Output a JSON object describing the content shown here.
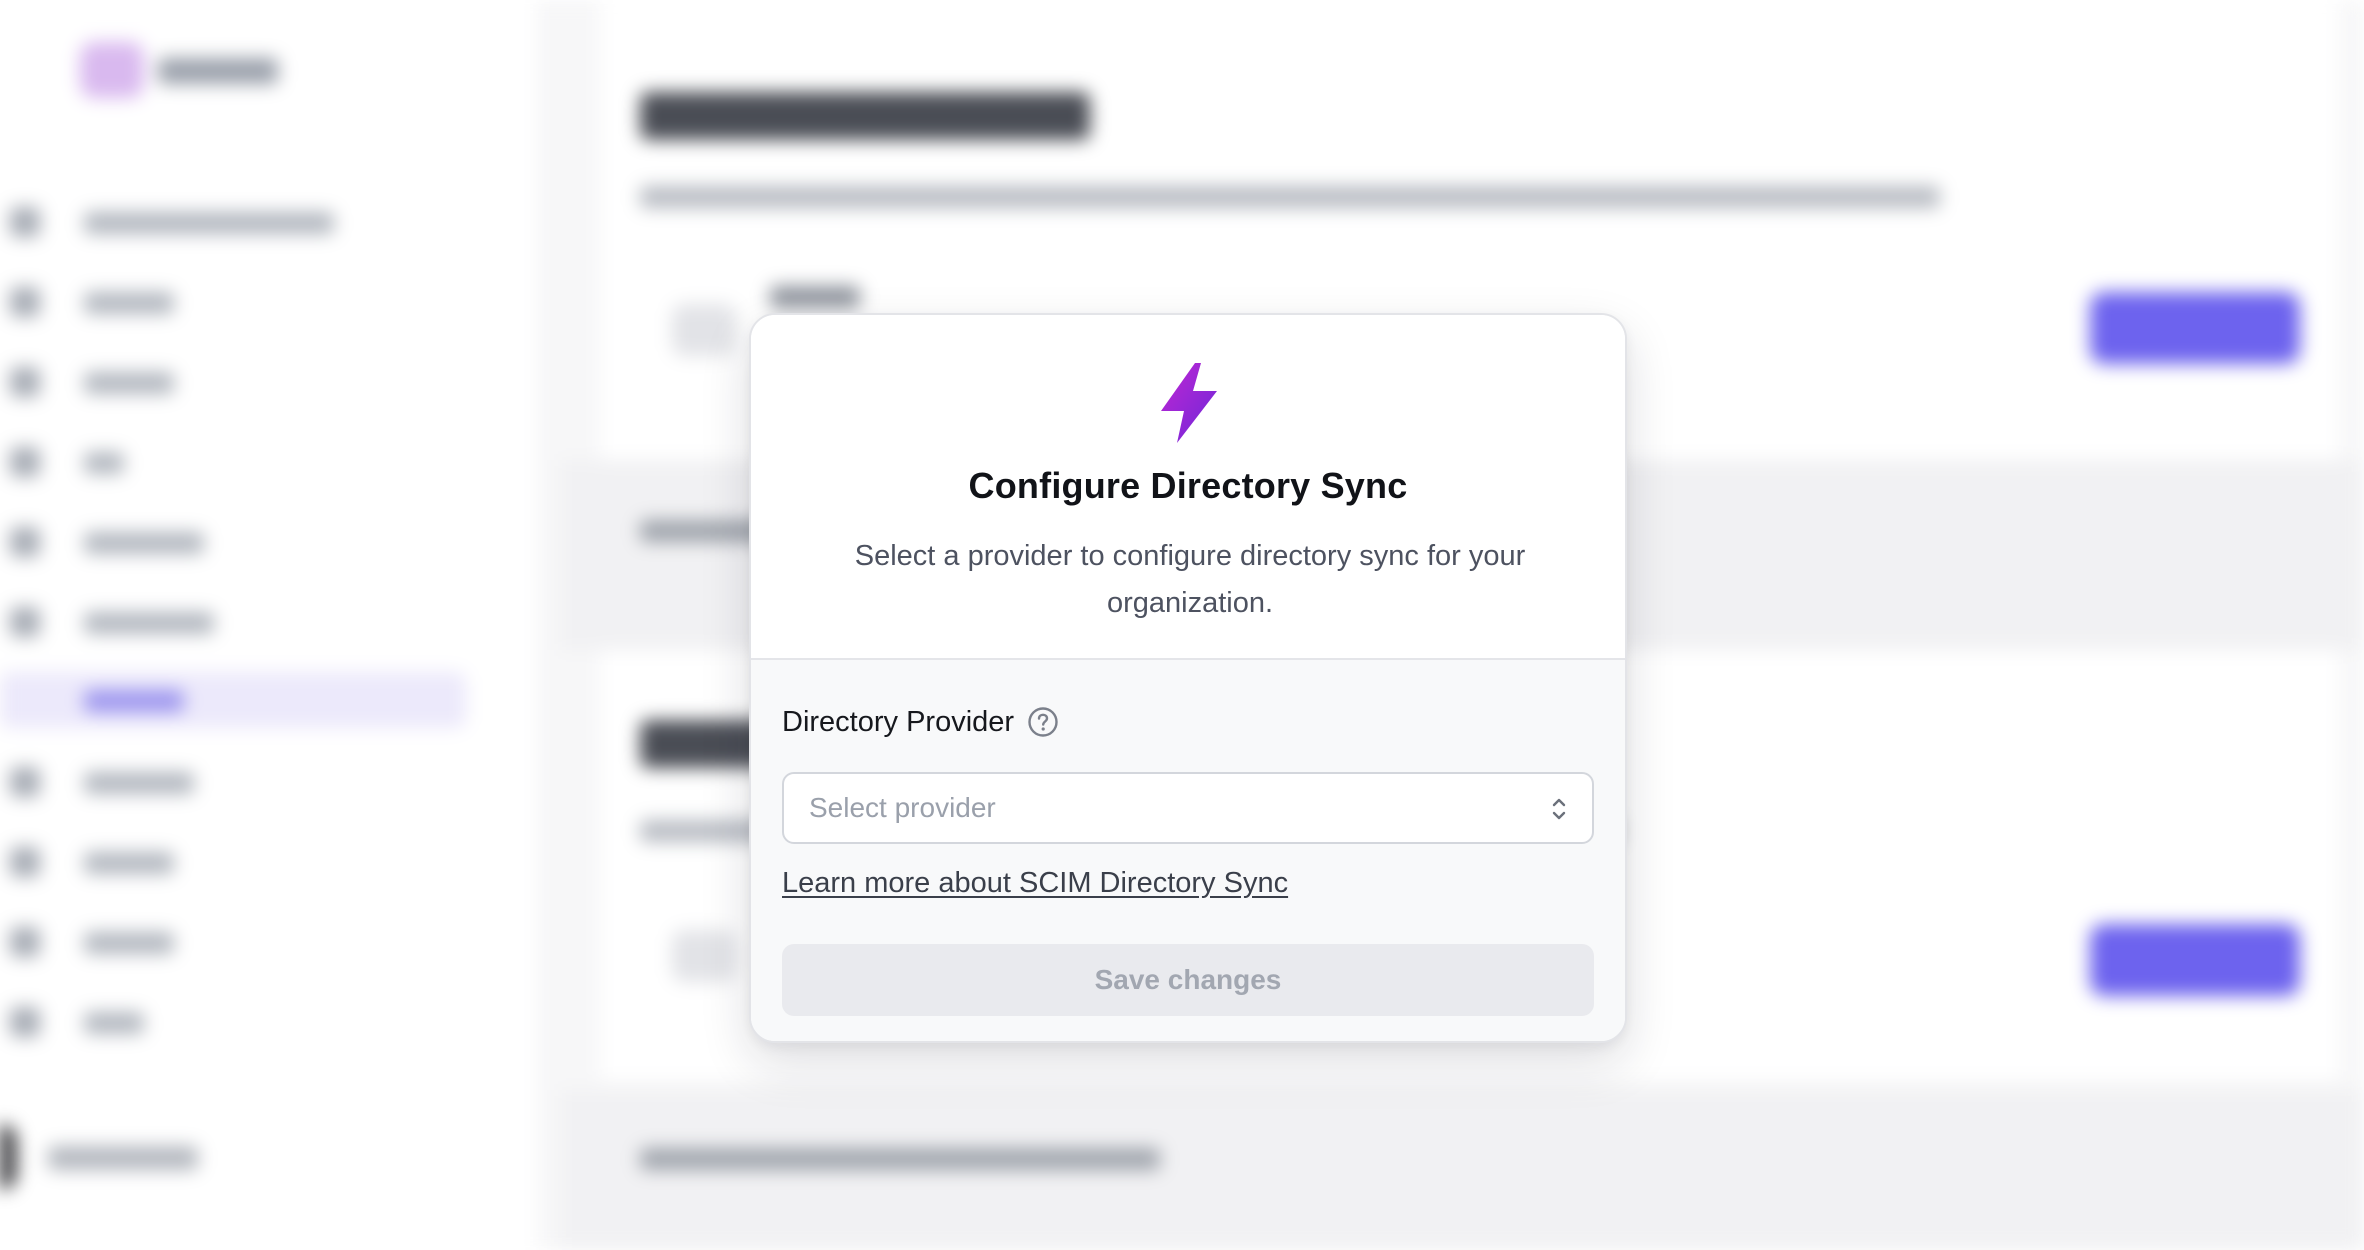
{
  "modal": {
    "icon": "lightning-bolt-icon",
    "title": "Configure Directory Sync",
    "subtitle": "Select a provider to configure directory sync for your organization.",
    "field_label": "Directory Provider",
    "help_icon": "question-circle-icon",
    "select": {
      "placeholder": "Select provider",
      "icon": "chevron-up-down-icon"
    },
    "learn_more_link": "Learn more about SCIM Directory Sync",
    "save_button": "Save changes"
  },
  "colors": {
    "accent_gradient_start": "#c026d3",
    "accent_gradient_end": "#6d28d9",
    "disabled_button_bg": "#e9eaee",
    "disabled_button_text": "#a2a7b1",
    "background_accent": "#6d63ee"
  }
}
